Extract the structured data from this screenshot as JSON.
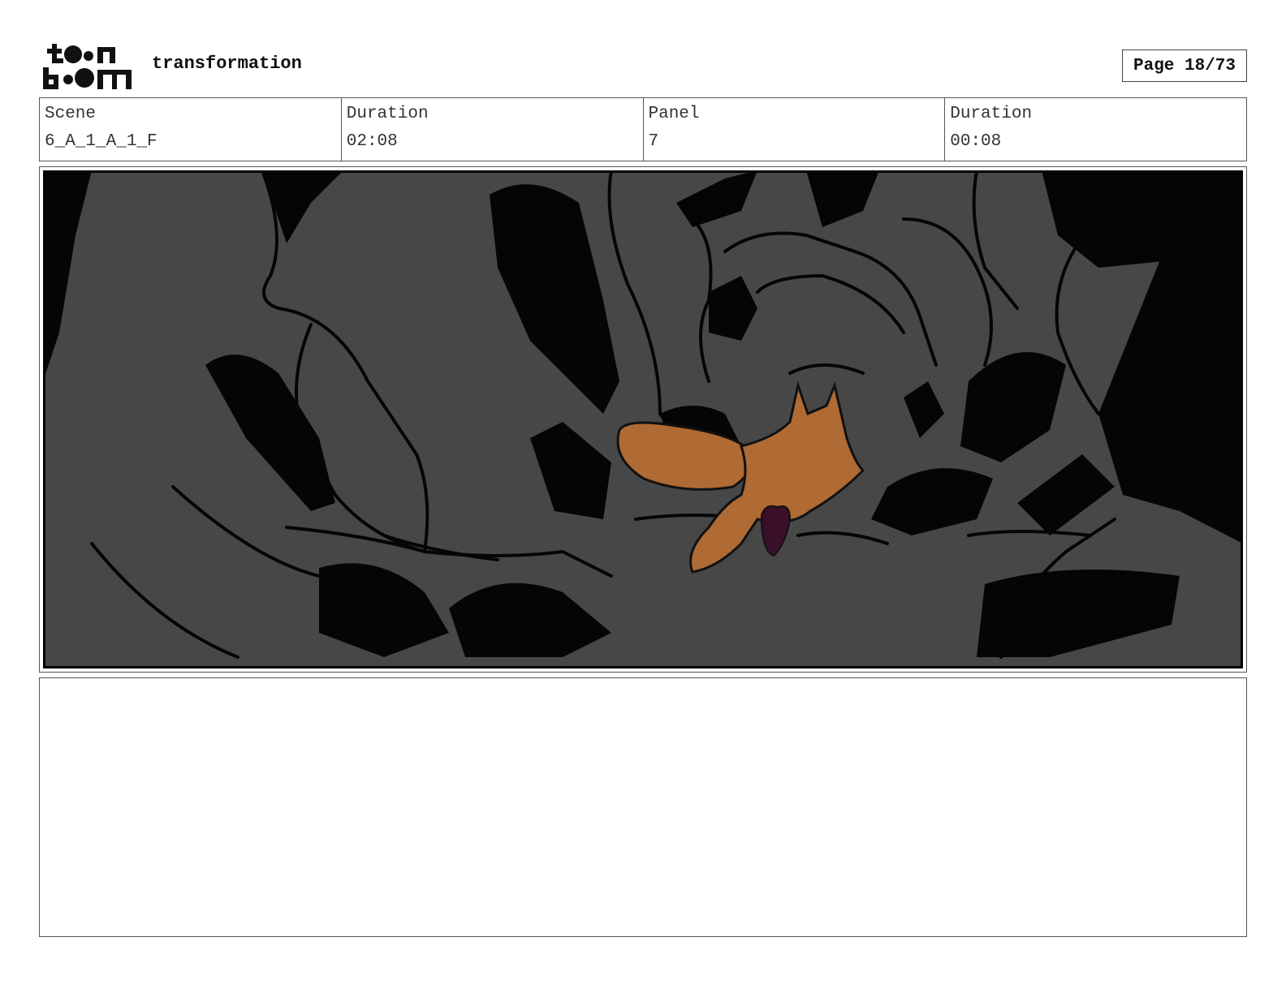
{
  "header": {
    "logo_name": "toon boom",
    "project_title": "transformation",
    "page_label": "Page 18/73"
  },
  "info": {
    "scene_label": "Scene",
    "scene_value": "6_A_1_A_1_F",
    "scene_duration_label": "Duration",
    "scene_duration_value": "02:08",
    "panel_label": "Panel",
    "panel_value": "7",
    "panel_duration_label": "Duration",
    "panel_duration_value": "00:08"
  },
  "panel": {
    "background_color": "#474747",
    "rock_color": "#050505",
    "fox_color": "#b06a33",
    "accent_color": "#3a0f2a"
  },
  "notes": {
    "text": ""
  }
}
